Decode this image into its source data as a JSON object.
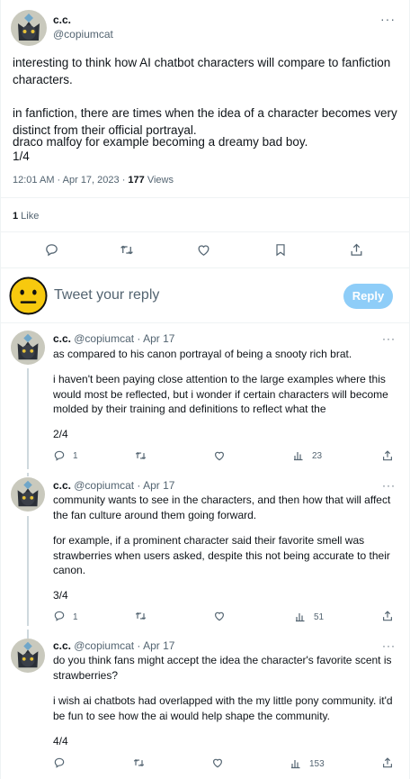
{
  "main_tweet": {
    "display_name": "c.c.",
    "handle": "@copiumcat",
    "paragraphs": [
      "interesting to think how AI chatbot characters will compare to fanfiction characters.",
      "in fanfiction, there are times when the idea of a character becomes very distinct from their official portrayal.",
      "draco malfoy for example becoming a dreamy bad boy.",
      "1/4"
    ],
    "time": "12:01 AM · Apr 17, 2023 · ",
    "views_count": "177",
    "views_label": " Views",
    "likes_count": "1",
    "likes_label": " Like"
  },
  "reply_box": {
    "placeholder": "Tweet your reply",
    "button": "Reply"
  },
  "replies": [
    {
      "display_name": "c.c.",
      "handle_date": "@copiumcat · Apr 17",
      "paragraphs": [
        "as compared to his canon portrayal of being a snooty rich brat.",
        "i haven't been paying close attention to the large examples where this would most be reflected, but i wonder if certain characters will become molded by their training and definitions to reflect what the",
        "2/4"
      ],
      "reply_count": "1",
      "views_count": "23"
    },
    {
      "display_name": "c.c.",
      "handle_date": "@copiumcat · Apr 17",
      "paragraphs": [
        "community wants to see in the characters, and then how that will affect the fan culture around them going forward.",
        "for example, if a prominent character said their favorite smell was strawberries when users asked, despite this not being accurate to their canon.",
        "3/4"
      ],
      "reply_count": "1",
      "views_count": "51"
    },
    {
      "display_name": "c.c.",
      "handle_date": "@copiumcat · Apr 17",
      "paragraphs": [
        "do you think fans might accept the idea the character's favorite scent is strawberries?",
        "i wish ai chatbots had overlapped with the my little pony community. it'd be fun to see how the ai would help shape the community.",
        "4/4"
      ],
      "reply_count": "",
      "views_count": "153"
    }
  ],
  "more_glyph": "···",
  "colors": {
    "accent": "#1d9bf0",
    "reply_button": "#8ecdf8",
    "muted": "#536471",
    "divider": "#eff3f4"
  }
}
